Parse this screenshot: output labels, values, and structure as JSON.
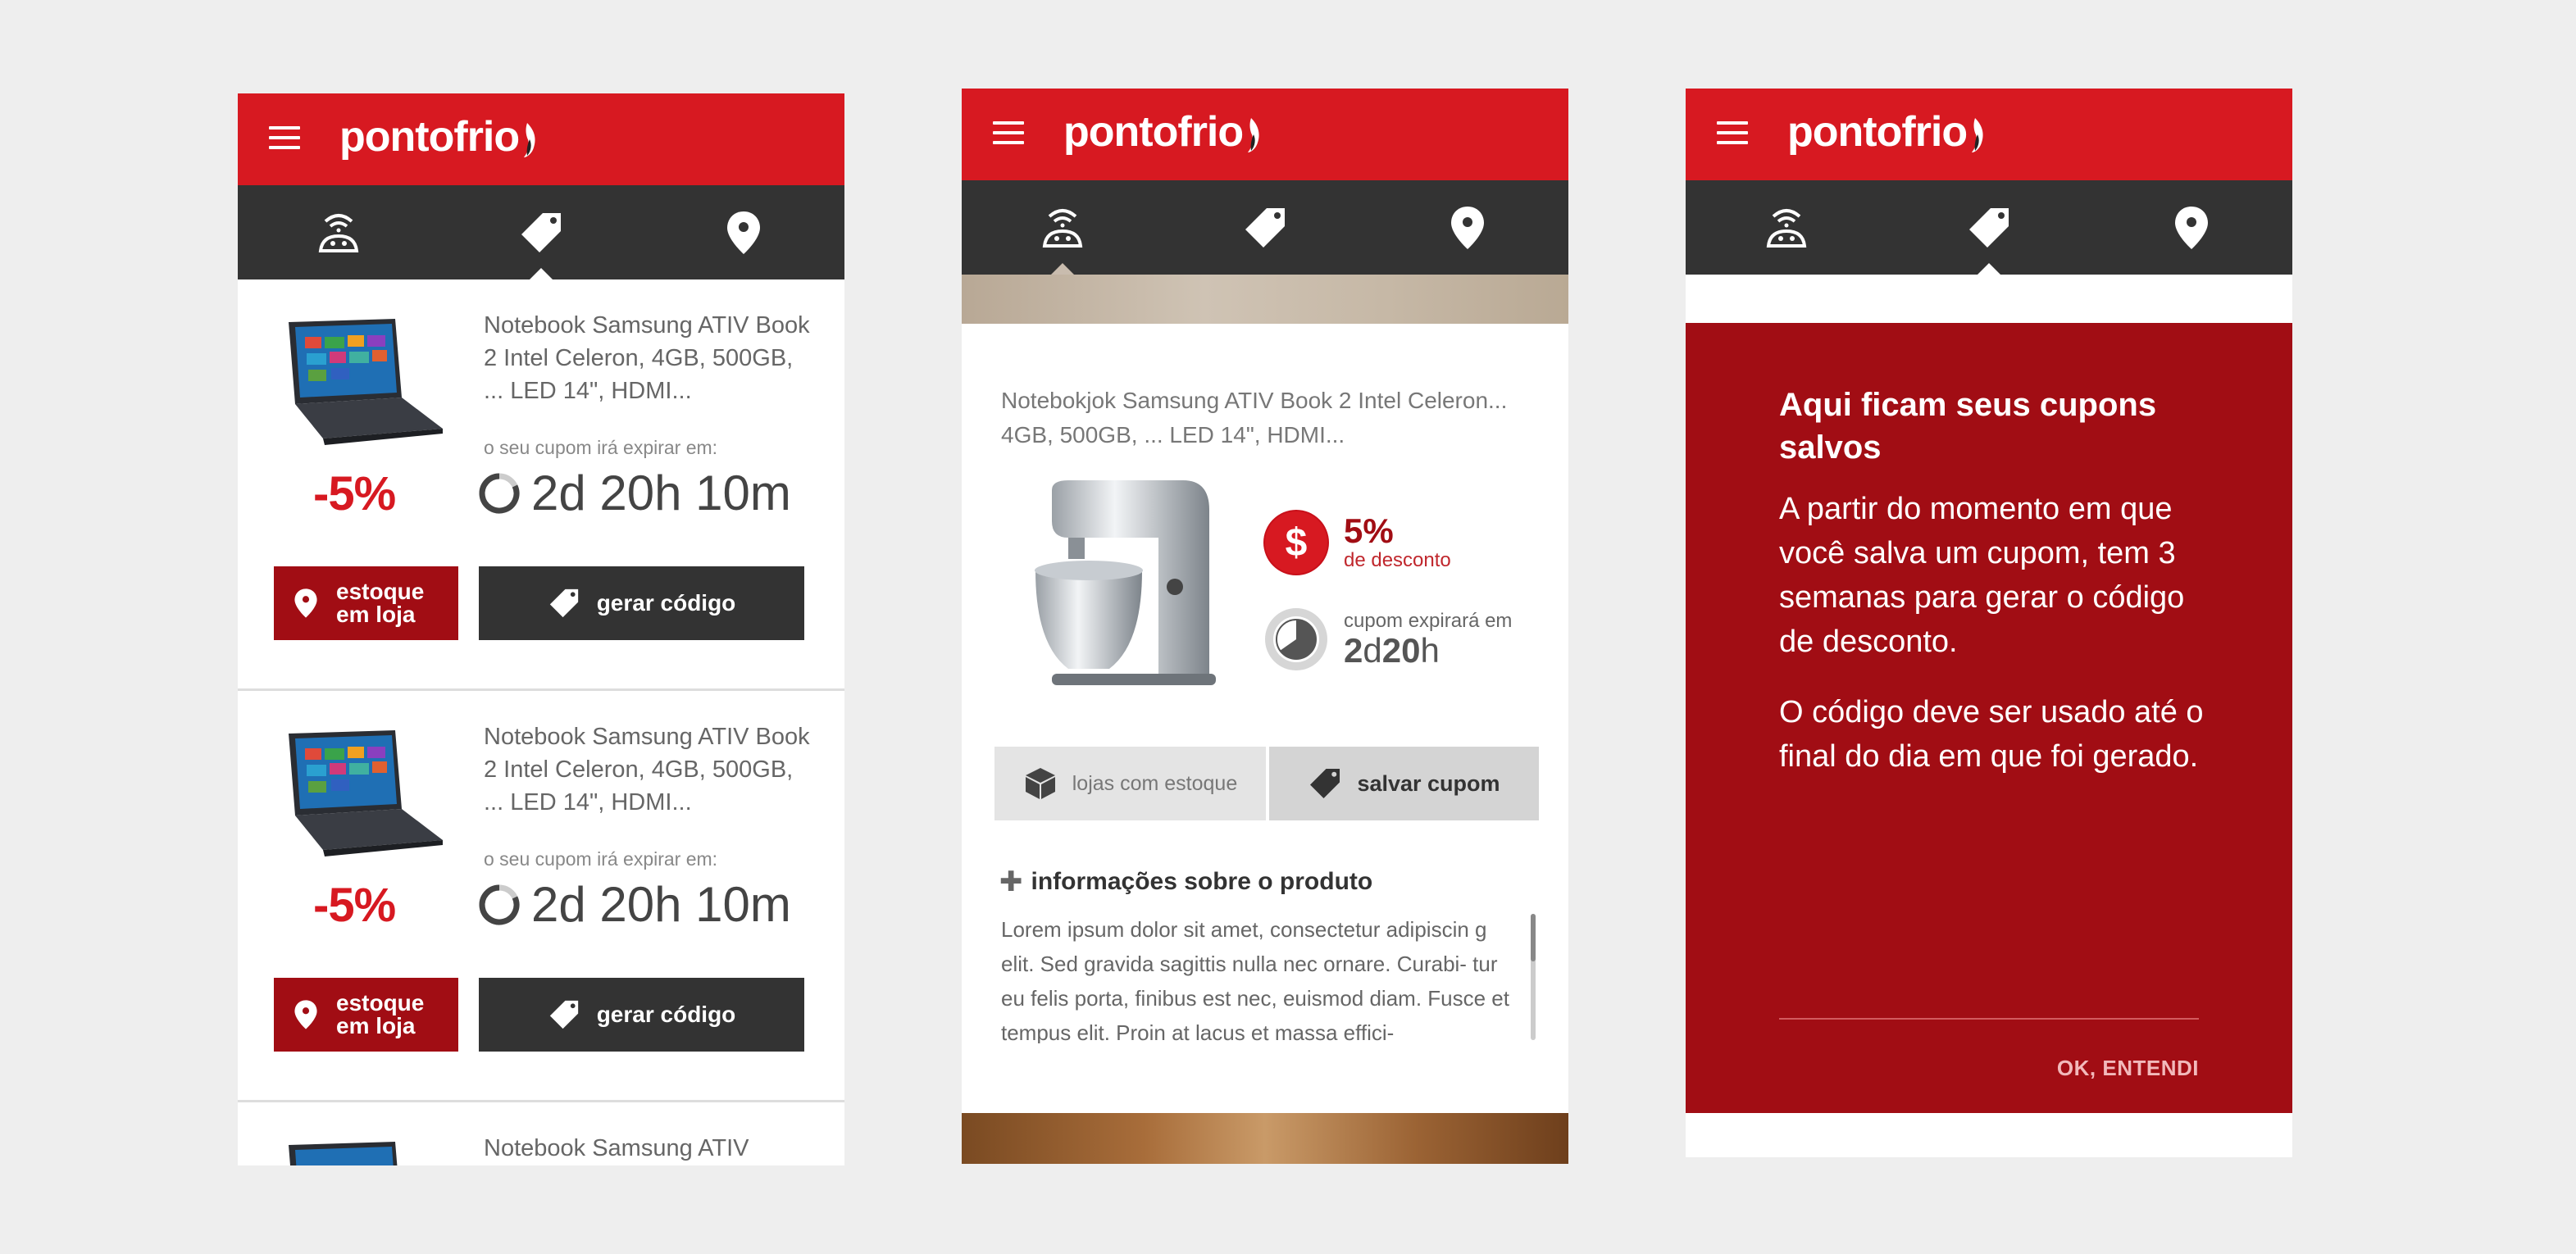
{
  "brand": {
    "logo_text": "pontofrio",
    "primary_color": "#d71921",
    "dark_red": "#a10d14",
    "nav_bg": "#333333"
  },
  "nav": {
    "items": [
      "coupon-robot-icon",
      "tag-icon",
      "location-pin-icon"
    ]
  },
  "list_screen": {
    "coupons": [
      {
        "title": "Notebook Samsung ATIV Book 2 Intel Celeron, 4GB, 500GB, ... LED 14\", HDMI...",
        "discount": "-5%",
        "expire_label": "o seu cupom irá expirar em:",
        "timer": "2d 20h 10m",
        "store_label_1": "estoque",
        "store_label_2": "em loja",
        "code_label": "gerar código"
      },
      {
        "title": "Notebook Samsung ATIV Book 2 Intel Celeron, 4GB, 500GB, ... LED 14\", HDMI...",
        "discount": "-5%",
        "expire_label": "o seu cupom irá expirar em:",
        "timer": "2d 20h 10m",
        "store_label_1": "estoque",
        "store_label_2": "em loja",
        "code_label": "gerar código"
      },
      {
        "title": "Notebook Samsung ATIV"
      }
    ]
  },
  "detail_screen": {
    "title": "Notebokjok Samsung ATIV Book 2 Intel Celeron... 4GB, 500GB, ... LED 14\", HDMI...",
    "discount_value": "5%",
    "discount_label": "de desconto",
    "expire_label": "cupom expirará em",
    "expire_days": "2",
    "expire_days_unit": "d",
    "expire_hours": "20",
    "expire_hours_unit": "h",
    "stores_button": "lojas com estoque",
    "save_button": "salvar cupom",
    "info_toggle": "informações sobre o produto",
    "info_text": "Lorem ipsum dolor sit amet, consectetur adipiscin g elit. Sed gravida sagittis nulla nec ornare. Curabi- tur eu felis porta, finibus est nec, euismod diam. Fusce et tempus elit. Proin at lacus et massa effici-"
  },
  "onboarding_screen": {
    "heading": "Aqui ficam seus cupons salvos",
    "paragraph_1": "A partir do momento em que você salva um cupom, tem 3 semanas para gerar o código de desconto.",
    "paragraph_2": "O código deve ser usado até o final do dia em que foi gerado.",
    "ok_button": "OK, ENTENDI"
  }
}
